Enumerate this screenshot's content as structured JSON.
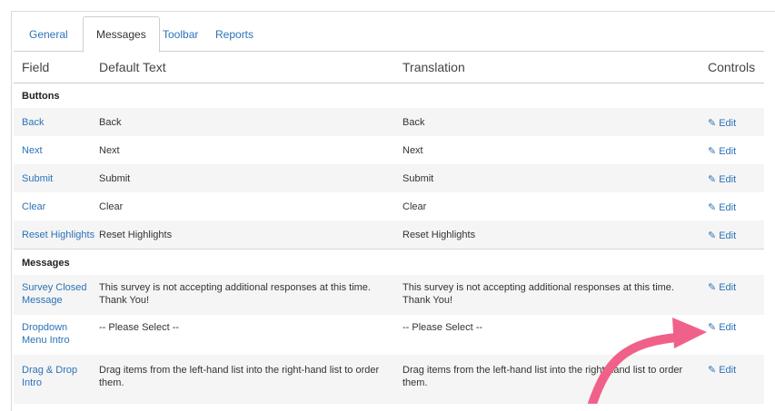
{
  "tabs": [
    {
      "label": "General",
      "active": false
    },
    {
      "label": "Messages",
      "active": true
    },
    {
      "label": "Toolbar",
      "active": false
    },
    {
      "label": "Reports",
      "active": false
    }
  ],
  "table": {
    "headers": [
      "Field",
      "Default Text",
      "Translation",
      "Controls"
    ],
    "sections": [
      {
        "title": "Buttons",
        "rows": [
          {
            "field": "Back",
            "default": "Back",
            "translation": "Back",
            "control": "Edit"
          },
          {
            "field": "Next",
            "default": "Next",
            "translation": "Next",
            "control": "Edit"
          },
          {
            "field": "Submit",
            "default": "Submit",
            "translation": "Submit",
            "control": "Edit"
          },
          {
            "field": "Clear",
            "default": "Clear",
            "translation": "Clear",
            "control": "Edit"
          },
          {
            "field": "Reset Highlights",
            "default": "Reset Highlights",
            "translation": "Reset Highlights",
            "control": "Edit"
          }
        ]
      },
      {
        "title": "Messages",
        "rows": [
          {
            "field": "Survey Closed Message",
            "default": "This survey is not accepting additional responses at this time. Thank You!",
            "translation": "This survey is not accepting additional responses at this time. Thank You!",
            "control": "Edit"
          },
          {
            "field": "Dropdown Menu Intro",
            "default": "-- Please Select --",
            "translation": "-- Please Select --",
            "control": "Edit"
          },
          {
            "field": "Drag & Drop Intro",
            "default": "Drag items from the left-hand list into the right-hand list to order them.",
            "translation": "Drag items from the left-hand list into the right-hand list to order them.",
            "control": "Edit"
          }
        ]
      }
    ]
  },
  "colors": {
    "link": "#2b72b8",
    "arrow": "#f0618a",
    "alt_row": "#f5f5f5"
  },
  "icons": {
    "edit": "pencil-icon"
  }
}
